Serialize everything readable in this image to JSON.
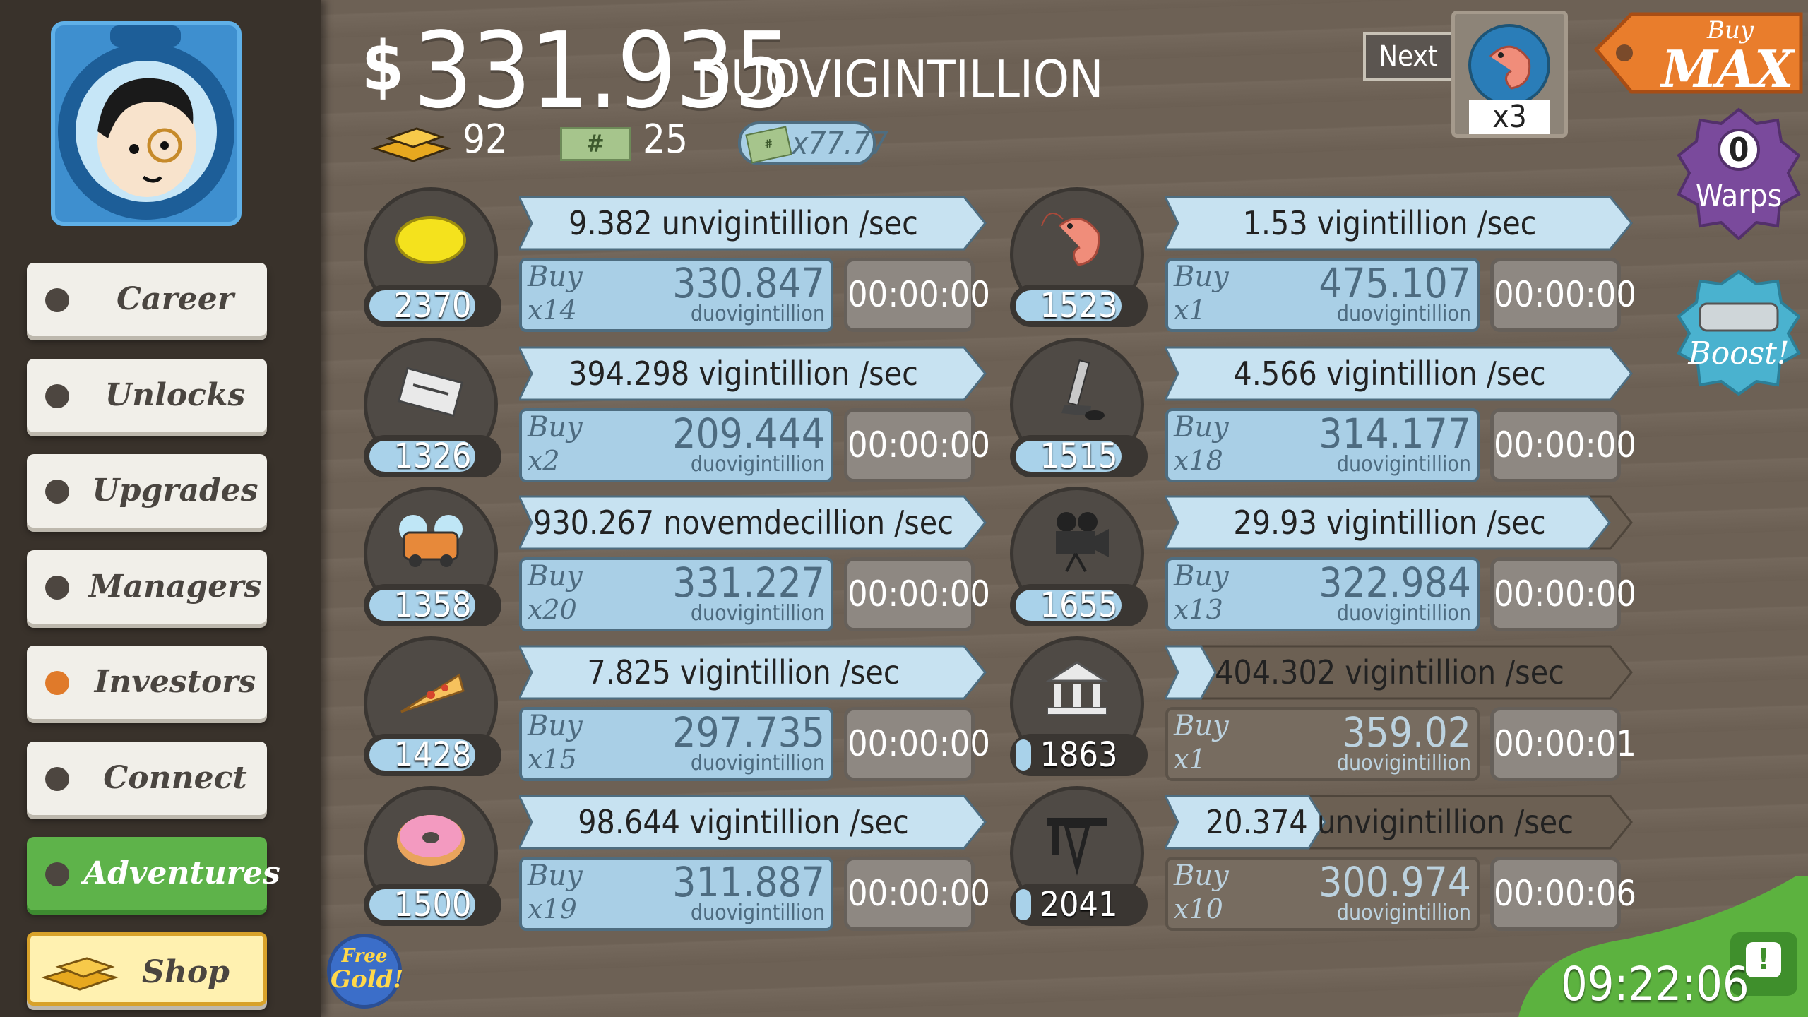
{
  "header": {
    "currency_symbol": "$",
    "money_value": "331.935",
    "money_unit": "DUOVIGINTILLION",
    "gold_count": "92",
    "megabucks_count": "25",
    "multiplier": "x77.77"
  },
  "nav": [
    {
      "label": "Career"
    },
    {
      "label": "Unlocks"
    },
    {
      "label": "Upgrades"
    },
    {
      "label": "Managers"
    },
    {
      "label": "Investors"
    },
    {
      "label": "Connect"
    },
    {
      "label": "Adventures"
    },
    {
      "label": "Shop"
    }
  ],
  "hud": {
    "next_label": "Next",
    "next_multiplier": "x3",
    "buy_label": "Buy",
    "max_label": "MAX",
    "warps_count": "0",
    "warps_label": "Warps",
    "boost_label": "Boost!",
    "free_gold_1": "Free",
    "free_gold_2": "Gold!",
    "clock": "09:22:06"
  },
  "businesses": [
    {
      "icon": "lemon-icon",
      "count": "2370",
      "rate": "9.382 unvigintillion /sec",
      "buy_label": "Buy",
      "buy_qty": "x14",
      "cost": "330.847",
      "cost_unit": "duovigintillion",
      "timer": "00:00:00",
      "progress": 1.0
    },
    {
      "icon": "newspaper-icon",
      "count": "1326",
      "rate": "394.298 vigintillion /sec",
      "buy_label": "Buy",
      "buy_qty": "x2",
      "cost": "209.444",
      "cost_unit": "duovigintillion",
      "timer": "00:00:00",
      "progress": 1.0
    },
    {
      "icon": "car-wash-icon",
      "count": "1358",
      "rate": "930.267 novemdecillion /sec",
      "buy_label": "Buy",
      "buy_qty": "x20",
      "cost": "331.227",
      "cost_unit": "duovigintillion",
      "timer": "00:00:00",
      "progress": 1.0
    },
    {
      "icon": "pizza-icon",
      "count": "1428",
      "rate": "7.825 vigintillion /sec",
      "buy_label": "Buy",
      "buy_qty": "x15",
      "cost": "297.735",
      "cost_unit": "duovigintillion",
      "timer": "00:00:00",
      "progress": 1.0
    },
    {
      "icon": "donut-icon",
      "count": "1500",
      "rate": "98.644 vigintillion /sec",
      "buy_label": "Buy",
      "buy_qty": "x19",
      "cost": "311.887",
      "cost_unit": "duovigintillion",
      "timer": "00:00:00",
      "progress": 1.0
    },
    {
      "icon": "shrimp-icon",
      "count": "1523",
      "rate": "1.53 vigintillion /sec",
      "buy_label": "Buy",
      "buy_qty": "x1",
      "cost": "475.107",
      "cost_unit": "duovigintillion",
      "timer": "00:00:00",
      "progress": 1.0
    },
    {
      "icon": "hockey-icon",
      "count": "1515",
      "rate": "4.566 vigintillion /sec",
      "buy_label": "Buy",
      "buy_qty": "x18",
      "cost": "314.177",
      "cost_unit": "duovigintillion",
      "timer": "00:00:00",
      "progress": 1.0
    },
    {
      "icon": "movie-camera-icon",
      "count": "1655",
      "rate": "29.93 vigintillion /sec",
      "buy_label": "Buy",
      "buy_qty": "x13",
      "cost": "322.984",
      "cost_unit": "duovigintillion",
      "timer": "00:00:00",
      "progress": 0.95
    },
    {
      "icon": "bank-icon",
      "count": "1863",
      "rate": "404.302 vigintillion /sec",
      "buy_label": "Buy",
      "buy_qty": "x1",
      "cost": "359.02",
      "cost_unit": "duovigintillion",
      "timer": "00:00:01",
      "progress": 0.05
    },
    {
      "icon": "oil-rig-icon",
      "count": "2041",
      "rate": "20.374 unvigintillion /sec",
      "buy_label": "Buy",
      "buy_qty": "x10",
      "cost": "300.974",
      "cost_unit": "duovigintillion",
      "timer": "00:00:06",
      "progress": 0.3
    }
  ],
  "colors": {
    "accent": "#a9cfe6",
    "sidebar": "#39322b",
    "adventures_green": "#5eb34a",
    "investors_dot": "#e07a2a"
  }
}
